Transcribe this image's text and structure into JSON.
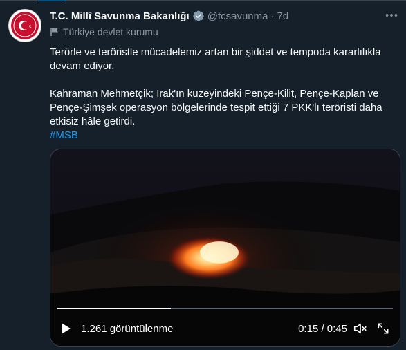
{
  "tweet": {
    "display_name": "T.C. Millî Savunma Bakanlığı",
    "handle": "@tcsavunma",
    "separator": "·",
    "time": "7d",
    "affiliation": "Türkiye devlet kurumu",
    "text_line1": "Terörle ve teröristle mücadelemiz artan bir şiddet ve tempoda kararlılıkla devam ediyor.",
    "text_line2": "Kahraman Mehmetçik; Irak'ın kuzeyindeki Pençe-Kilit, Pençe-Kaplan ve Pençe-Şimşek operasyon bölgelerinde tespit ettiği 7 PKK'lı teröristi daha etkisiz hâle getirdi.",
    "hashtag": "#MSB"
  },
  "video": {
    "views": "1.261 görüntülenme",
    "time": "0:15 / 0:45",
    "progress": 0.339
  },
  "colors": {
    "background": "#15202b",
    "accent": "#1d9bf0",
    "secondary_text": "#8b98a5"
  },
  "icons": [
    "avatar",
    "verified-badge-icon",
    "more-icon",
    "flag-icon",
    "play-icon",
    "volume-icon",
    "fullscreen-icon"
  ]
}
